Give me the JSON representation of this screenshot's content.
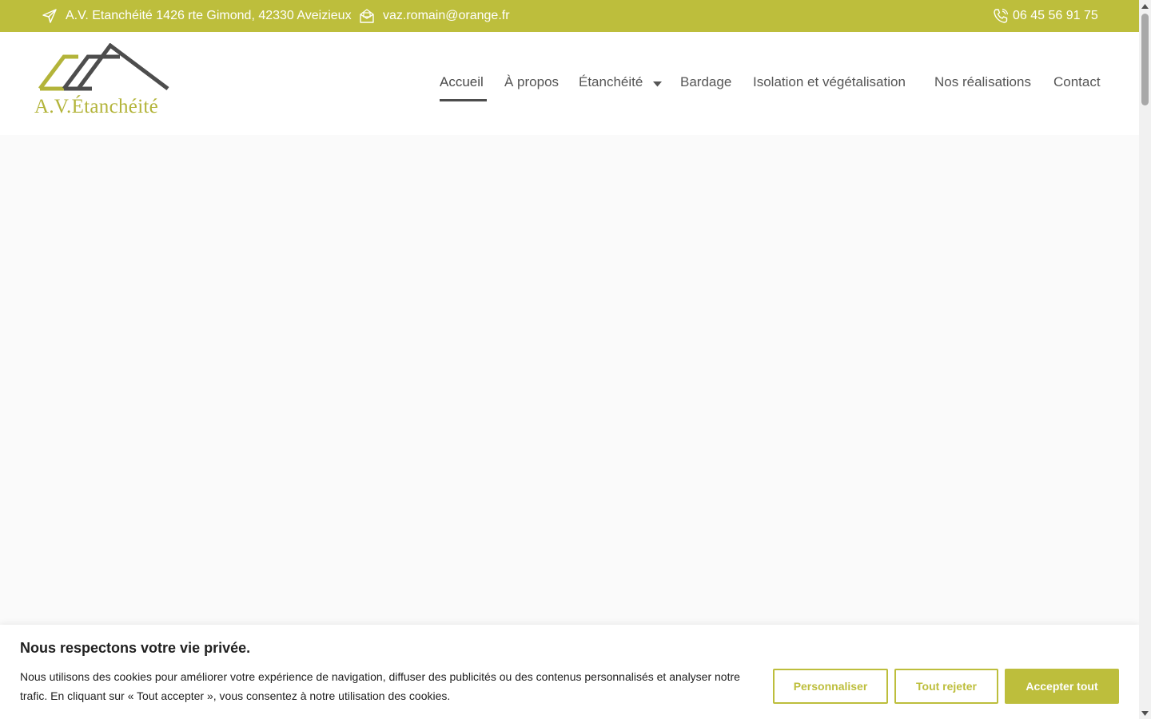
{
  "topbar": {
    "address": "A.V. Etanchéité 1426 rte Gimond, 42330 Aveizieux",
    "email": "vaz.romain@orange.fr",
    "phone": "06 45 56 91 75",
    "address_icon": "location-arrow-icon",
    "email_icon": "envelope-icon",
    "phone_icon": "phone-icon"
  },
  "header": {
    "logo_text": "A.V.Étanchéité",
    "nav": [
      {
        "label": "Accueil",
        "active": true
      },
      {
        "label": "À propos"
      },
      {
        "label": "Étanchéité",
        "has_dropdown": true
      },
      {
        "label": "Bardage"
      },
      {
        "label": "Isolation et végétalisation"
      },
      {
        "label": "Nos réalisations"
      },
      {
        "label": "Contact"
      }
    ]
  },
  "cookie": {
    "title": "Nous respectons votre vie privée.",
    "text": "Nous utilisons des cookies pour améliorer votre expérience de navigation, diffuser des publicités ou des contenus personnalisés et analyser notre trafic. En cliquant sur « Tout accepter », vous consentez à notre utilisation des cookies.",
    "customize_label": "Personnaliser",
    "reject_label": "Tout rejeter",
    "accept_label": "Accepter tout"
  },
  "colors": {
    "accent": "#bdbe3c",
    "logo_dark": "#4d4d4d",
    "text": "#212121"
  }
}
